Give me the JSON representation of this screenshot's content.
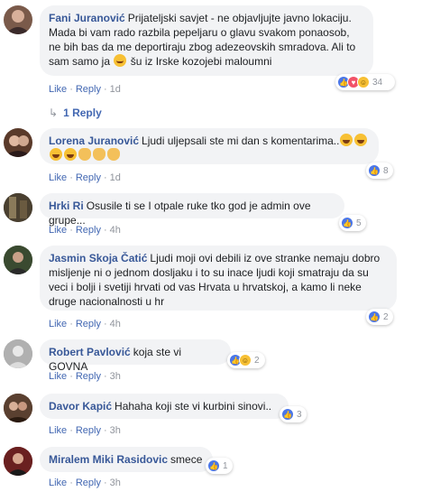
{
  "comments": [
    {
      "author": "Fani Juranović",
      "text_parts": [
        "Prijateljski savjet - ne objavljujte javno lokaciju. Mada bi vam rado razbila pepeljaru o glavu svakom ponaosob, ne bih bas da me deportiraju zbog adezeovskih smradova. Ali to sam samo ja ",
        " šu iz Irske kozojebi maloumni"
      ],
      "emoji": [
        "smile"
      ],
      "like": "Like",
      "reply": "Reply",
      "time": "1d",
      "reactions": [
        "like",
        "heart",
        "haha"
      ],
      "reaction_count": "34",
      "avatar_color": "#7a5a4a"
    },
    {
      "author": "Lorena Juranović",
      "text": "Ljudi uljepsali ste mi dan s komentarima..",
      "emoji": [
        "laugh",
        "laugh",
        "laugh",
        "laugh",
        "hand",
        "hand",
        "hand"
      ],
      "like": "Like",
      "reply": "Reply",
      "time": "1d",
      "reactions": [
        "like"
      ],
      "reaction_count": "8",
      "avatar_color": "#5a3a2a"
    },
    {
      "author": "Hrki Ri",
      "text": "Osusile ti se I otpale ruke tko god je admin ove grupe...",
      "like": "Like",
      "reply": "Reply",
      "time": "4h",
      "reactions": [
        "like"
      ],
      "reaction_count": "5",
      "avatar_color": "#3a3a3a"
    },
    {
      "author": "Jasmin Skoja Čatić",
      "text": "Ljudi moji ovi debili iz ove stranke nemaju dobro misljenje ni o jednom dosljaku i to su inace ljudi koji smatraju da su veci i bolji i svetiji hrvati od vas Hrvata u hrvatskoj, a kamo li neke druge nacionalnosti u hr",
      "like": "Like",
      "reply": "Reply",
      "time": "4h",
      "reactions": [
        "like"
      ],
      "reaction_count": "2",
      "avatar_color": "#4a5a3a"
    },
    {
      "author": "Robert Pavlović",
      "text": "koja ste vi GOVNA",
      "like": "Like",
      "reply": "Reply",
      "time": "3h",
      "reactions": [
        "like",
        "haha"
      ],
      "reaction_count": "2",
      "avatar_color": "#9a9a9a"
    },
    {
      "author": "Davor Kapić",
      "text": "Hahaha koji ste vi kurbini sinovi..",
      "like": "Like",
      "reply": "Reply",
      "time": "3h",
      "reactions": [
        "like"
      ],
      "reaction_count": "3",
      "avatar_color": "#6a4a3a"
    },
    {
      "author": "Miralem Miki Rasidovic",
      "text": "smece",
      "like": "Like",
      "reply": "Reply",
      "time": "3h",
      "reactions": [
        "like"
      ],
      "reaction_count": "1",
      "avatar_color": "#7a2a2a"
    }
  ],
  "replies_link": "1 Reply",
  "colors": {
    "author": "#385898",
    "link": "#4267b2",
    "bubble": "#f2f3f5",
    "muted": "#90949c"
  }
}
